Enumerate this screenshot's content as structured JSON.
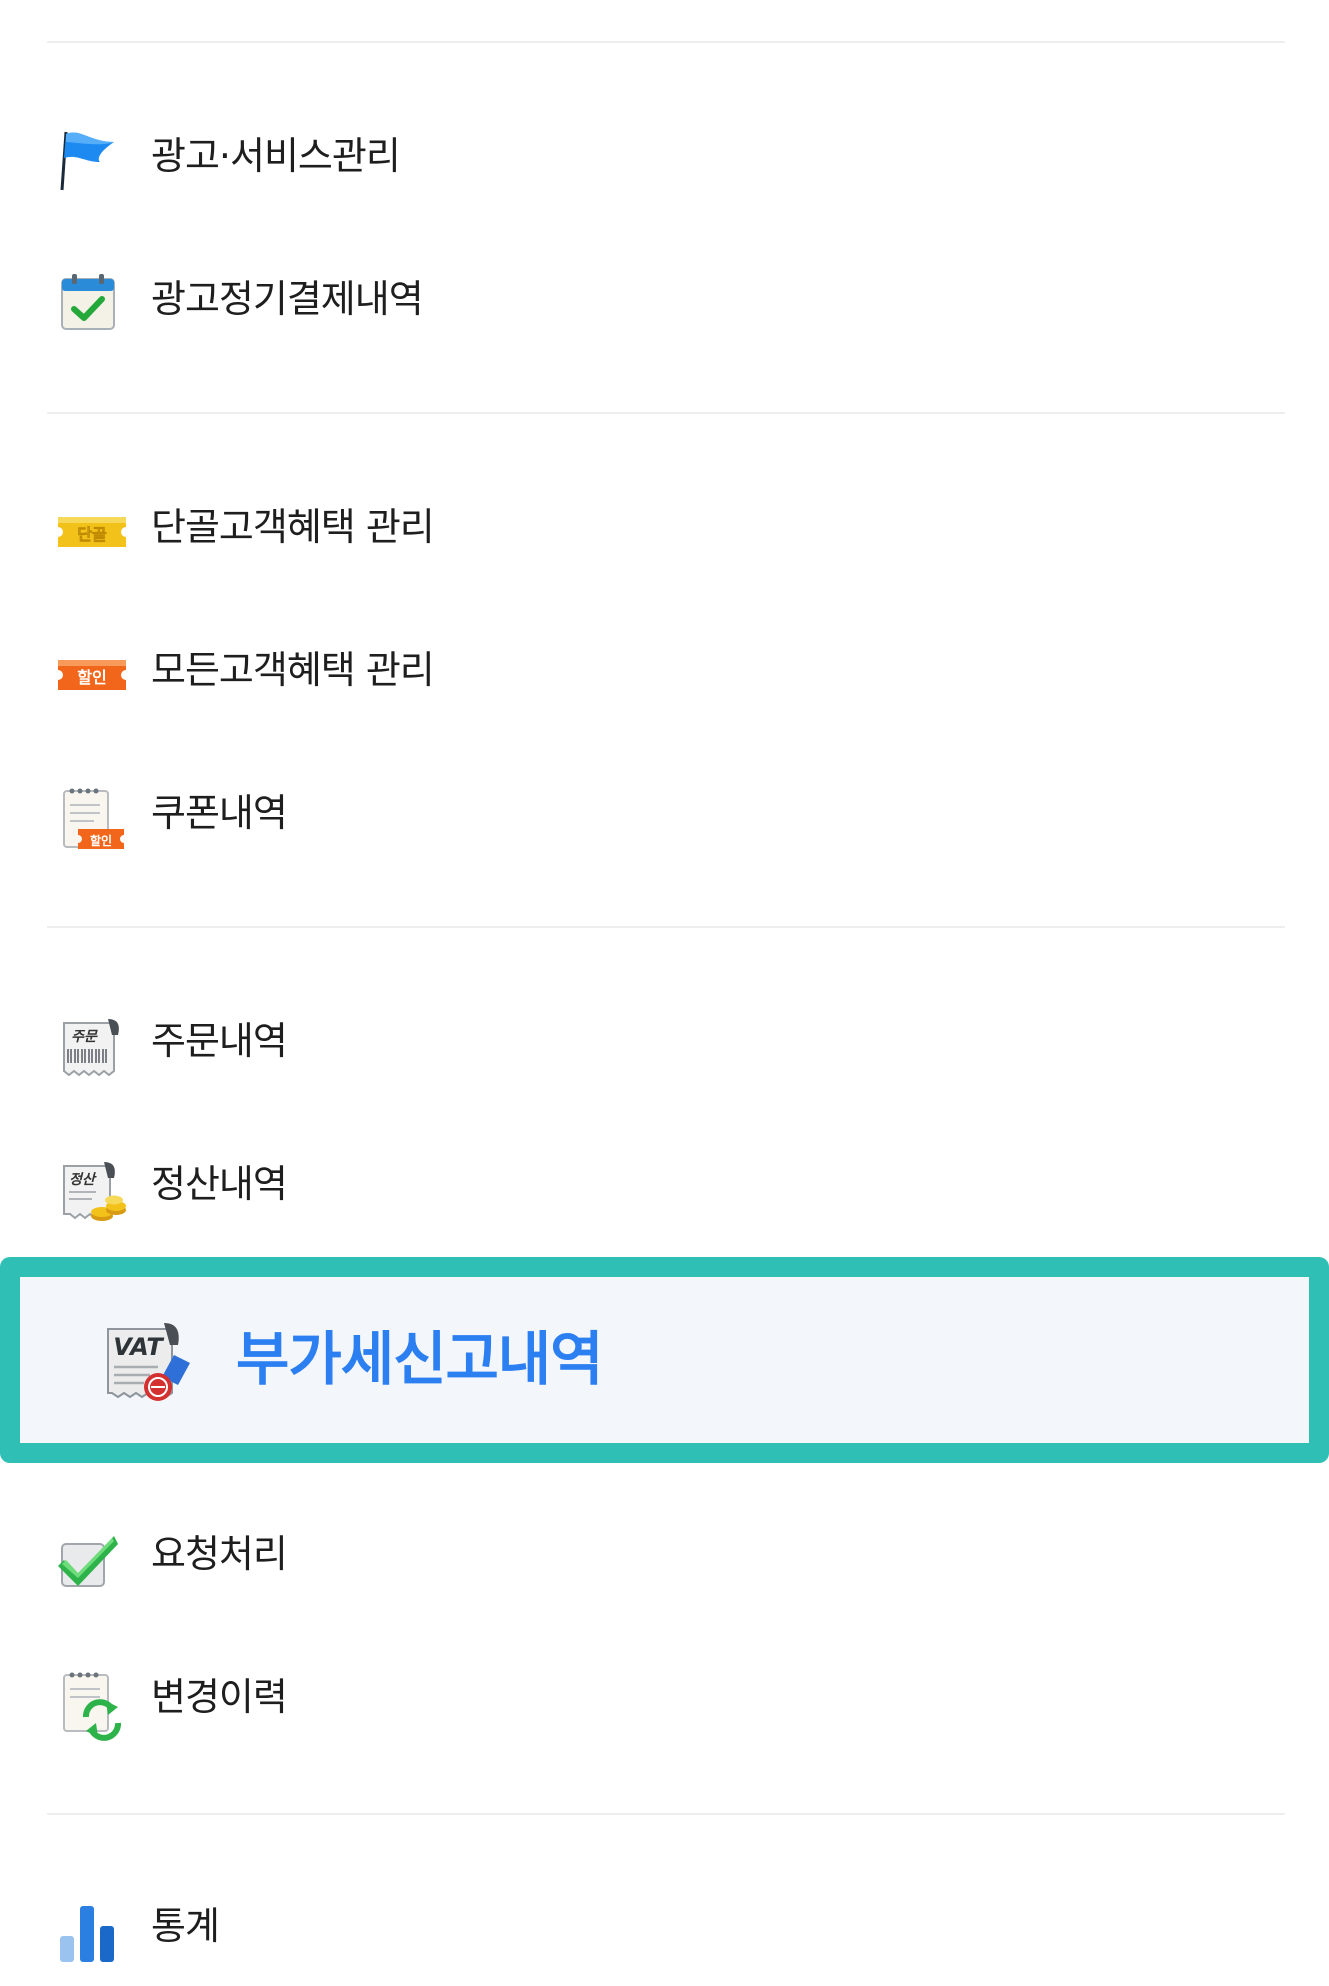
{
  "menu": {
    "groups": [
      {
        "items": [
          {
            "label": "광고·서비스관리",
            "icon": "flag-icon"
          },
          {
            "label": "광고정기결제내역",
            "icon": "calendar-check-icon"
          }
        ]
      },
      {
        "items": [
          {
            "label": "단골고객혜택 관리",
            "icon": "regular-customer-ticket-icon",
            "icon_text": "단골"
          },
          {
            "label": "모든고객혜택 관리",
            "icon": "discount-ticket-icon",
            "icon_text": "할인"
          },
          {
            "label": "쿠폰내역",
            "icon": "coupon-notepad-icon",
            "icon_text": "할인"
          }
        ]
      },
      {
        "items": [
          {
            "label": "주문내역",
            "icon": "order-receipt-icon",
            "icon_text": "주문"
          },
          {
            "label": "정산내역",
            "icon": "settlement-coins-icon",
            "icon_text": "정산"
          },
          {
            "label": "부가세신고내역",
            "icon": "vat-stamp-icon",
            "icon_text": "VAT",
            "selected": true
          },
          {
            "label": "요청처리",
            "icon": "checkmark-icon"
          },
          {
            "label": "변경이력",
            "icon": "history-refresh-icon"
          }
        ]
      },
      {
        "items": [
          {
            "label": "통계",
            "icon": "bar-chart-icon"
          }
        ]
      }
    ],
    "highlight_color": "#2fbfb4",
    "selected_text_color": "#2b7ff1",
    "selected_background": "#f3f6fb"
  }
}
